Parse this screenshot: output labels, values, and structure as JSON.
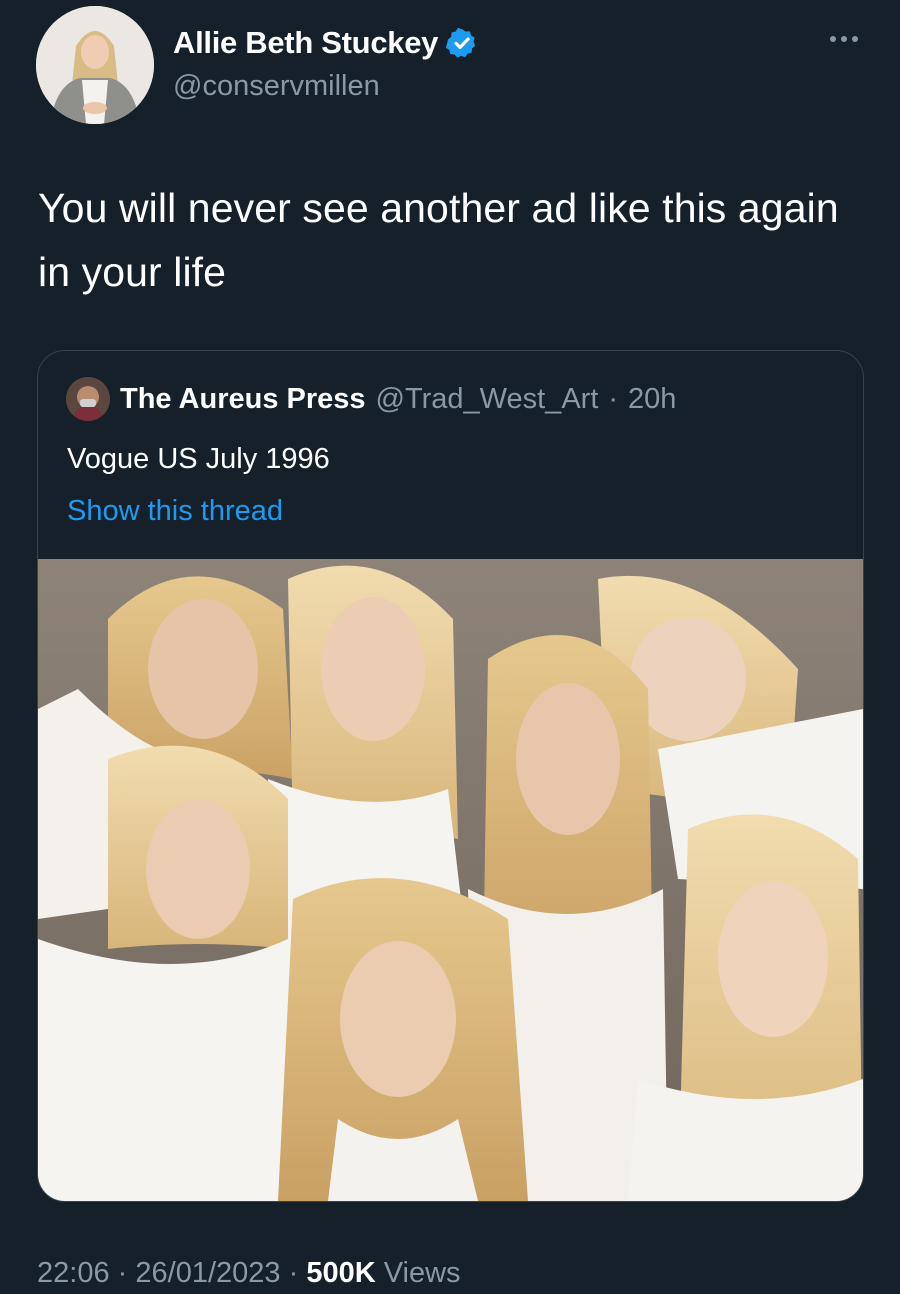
{
  "author": {
    "display_name": "Allie Beth Stuckey",
    "handle": "@conservmillen",
    "verified": true,
    "avatar_icon": "profile-photo"
  },
  "more_icon": "more-options-icon",
  "tweet": {
    "text": "You will never see another ad like this again in your life"
  },
  "quoted": {
    "display_name": "The Aureus Press",
    "handle": "@Trad_West_Art",
    "separator": "·",
    "time": "20h",
    "text": "Vogue US July 1996",
    "thread_link": "Show this thread",
    "image_icon": "photo-of-seven-blonde-models"
  },
  "meta": {
    "time": "22:06",
    "sep1": "·",
    "date": "26/01/2023",
    "sep2": "·",
    "views_count": "500K",
    "views_label": "Views"
  },
  "colors": {
    "background": "#15202b",
    "secondary_text": "#8b98a5",
    "link": "#1d9bf0",
    "border": "#38444d",
    "verified": "#1d9bf0"
  }
}
